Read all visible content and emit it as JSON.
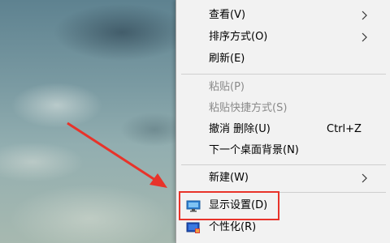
{
  "context_menu": {
    "items": [
      {
        "label": "查看(V)",
        "submenu": true
      },
      {
        "label": "排序方式(O)",
        "submenu": true
      },
      {
        "label": "刷新(E)"
      },
      {
        "label": "粘贴(P)",
        "disabled": true
      },
      {
        "label": "粘贴快捷方式(S)",
        "disabled": true
      },
      {
        "label": "撤消 删除(U)",
        "shortcut": "Ctrl+Z"
      },
      {
        "label": "下一个桌面背景(N)"
      },
      {
        "label": "新建(W)",
        "submenu": true
      },
      {
        "label": "显示设置(D)",
        "icon": "display-icon",
        "highlighted": true
      },
      {
        "label": "个性化(R)",
        "icon": "personalize-icon"
      }
    ]
  },
  "colors": {
    "annotation_red": "#e8332a",
    "menu_bg": "#f2f2f2",
    "disabled_text": "#8a8a8a"
  }
}
